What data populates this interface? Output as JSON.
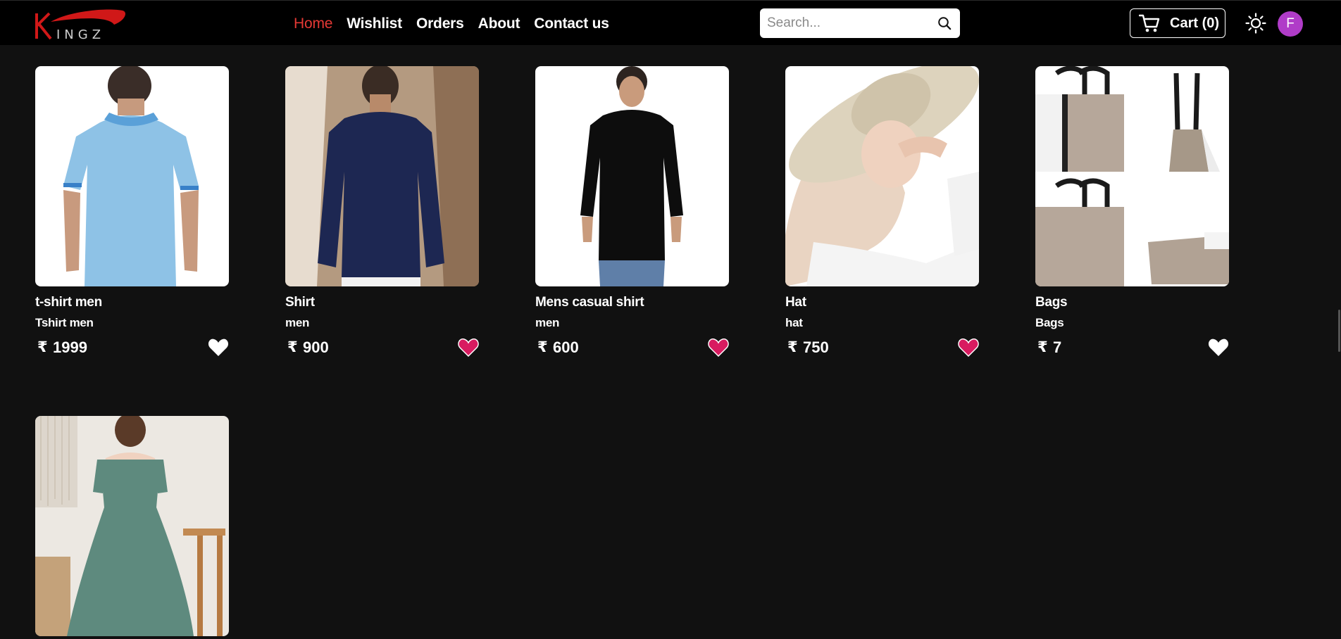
{
  "brand": {
    "logo_text": "KINGZ"
  },
  "nav": {
    "links": [
      {
        "label": "Home",
        "active": true
      },
      {
        "label": "Wishlist",
        "active": false
      },
      {
        "label": "Orders",
        "active": false
      },
      {
        "label": "About",
        "active": false
      },
      {
        "label": "Contact us",
        "active": false
      }
    ]
  },
  "search": {
    "placeholder": "Search...",
    "value": ""
  },
  "cart": {
    "label": "Cart (0)"
  },
  "user": {
    "avatar_initial": "F"
  },
  "currency_symbol": "₹",
  "colors": {
    "accent": "#e53935",
    "heart_active": "#d81b60",
    "heart_inactive": "#ffffff",
    "avatar": "#b03cc8",
    "background": "#111111"
  },
  "products": [
    {
      "title": "t-shirt men",
      "category": "Tshirt men",
      "price": "1999",
      "wishlisted": false,
      "image": "blue-polo-tshirt-photo"
    },
    {
      "title": "Shirt",
      "category": "men",
      "price": "900",
      "wishlisted": true,
      "image": "navy-shirt-photo"
    },
    {
      "title": "Mens casual shirt",
      "category": "men",
      "price": "600",
      "wishlisted": true,
      "image": "black-shirt-photo"
    },
    {
      "title": "Hat",
      "category": "hat",
      "price": "750",
      "wishlisted": true,
      "image": "sun-hat-photo"
    },
    {
      "title": "Bags",
      "category": "Bags",
      "price": "7",
      "wishlisted": false,
      "image": "handbags-photo"
    },
    {
      "image": "green-dress-photo"
    }
  ]
}
